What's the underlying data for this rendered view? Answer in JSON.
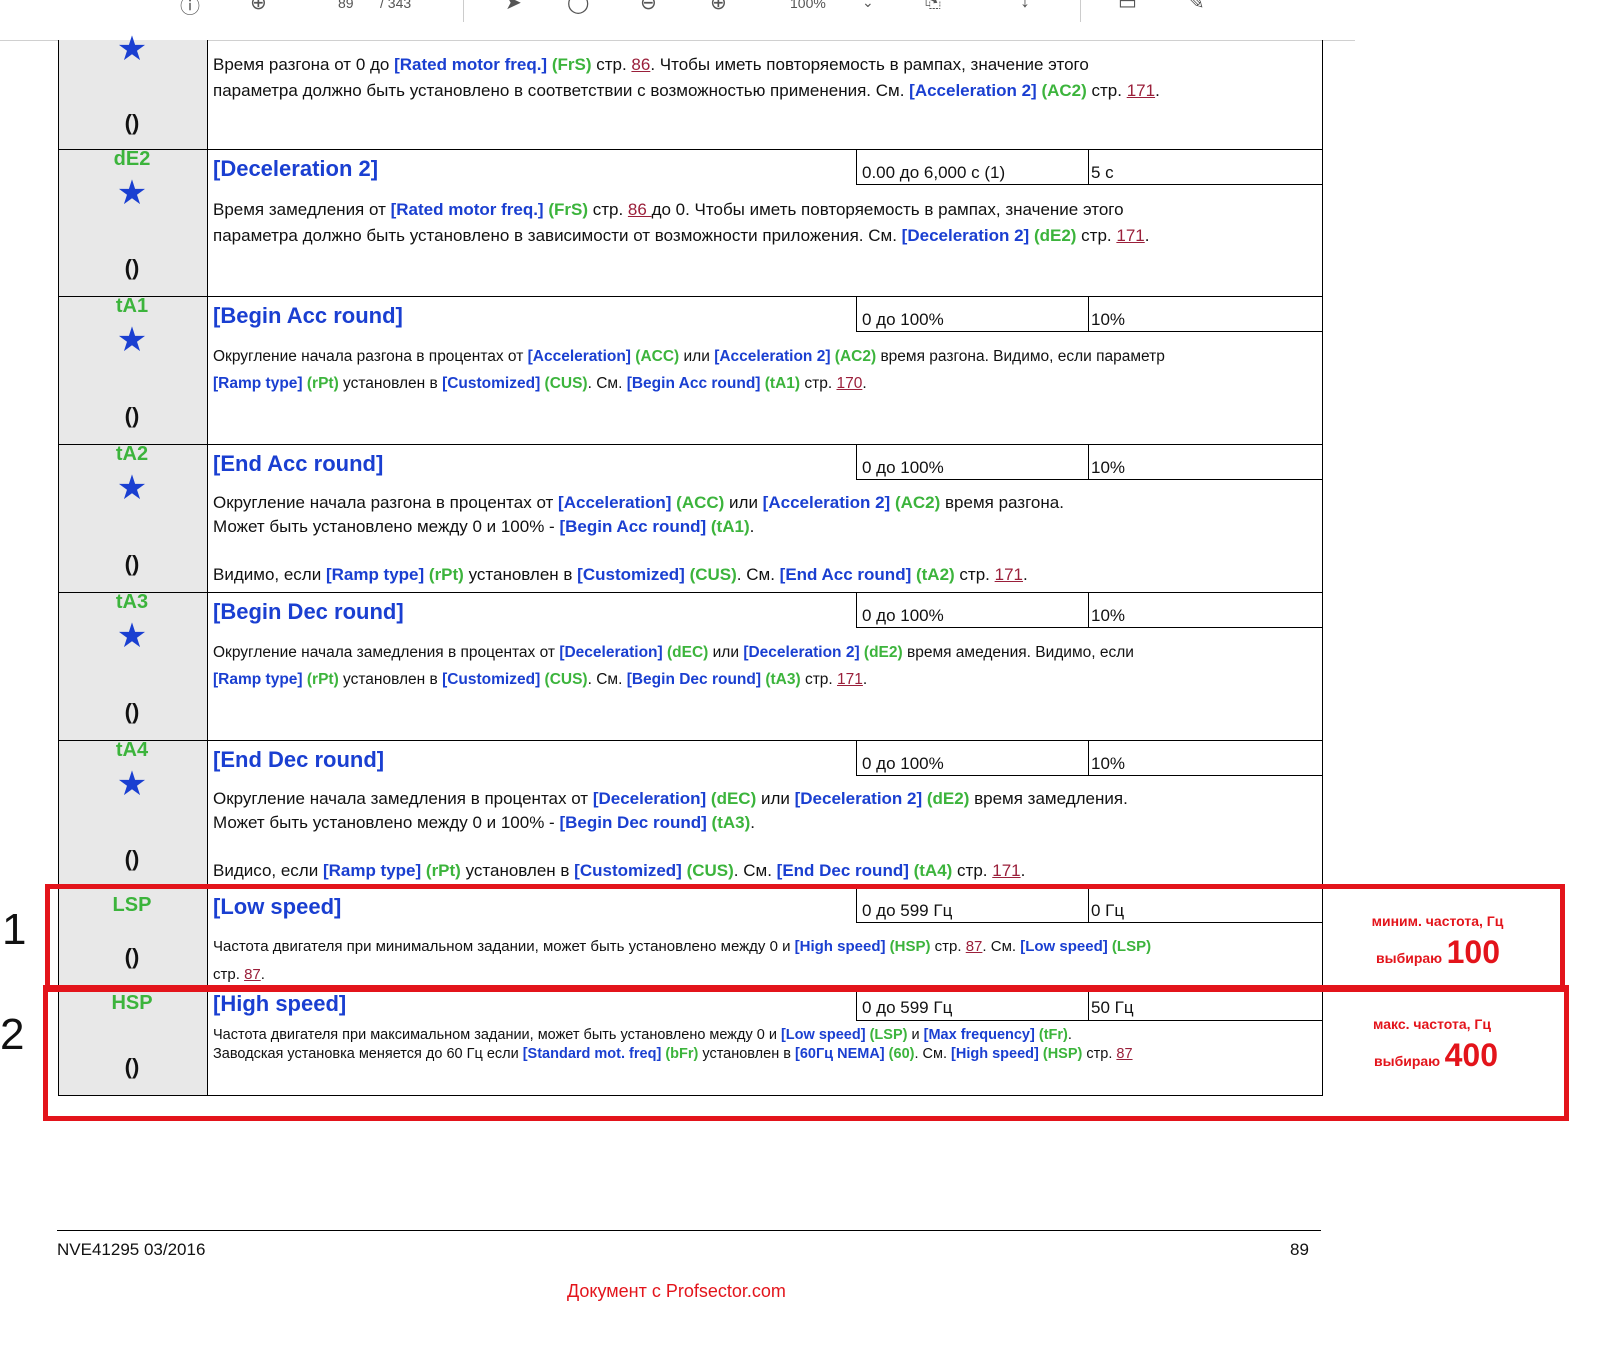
{
  "toolbar": {
    "page_current": "89",
    "page_total": "/ 343",
    "zoom": "100%"
  },
  "rows": [
    {
      "code": "",
      "title": "",
      "range": "",
      "default": "",
      "desc_html": "Время разгона от 0 до <span class=\"b\">[Rated motor freq.]</span> <span class=\"g\">(FrS)</span> стр. <span class=\"pg\">86</span>. Чтобы иметь повторяемость в рампах, значение этого<br>параметра должно быть установлено в соответствии с возможностью применения. См. <span class=\"b\">[Acceleration 2]</span> <span class=\"g\">(AC2)</span> стр. <span class=\"pg\">171</span>."
    },
    {
      "code": "dE2",
      "title": "[Deceleration 2]",
      "range": "0.00 до 6,000 с (1)",
      "default": "5 с",
      "desc_html": "Время замедления от <span class=\"b\">[Rated motor freq.]</span> <span class=\"g\">(FrS)</span> стр. <span class=\"pg\">86 </span>до 0. Чтобы иметь повторяемость в рампах, значение этого<br>параметра должно быть установлено в зависимости от возможности приложения. См. <span class=\"b\">[Deceleration 2]</span> <span class=\"g\">(dE2)</span> стр. <span class=\"pg\">171</span>."
    },
    {
      "code": "tA1",
      "title": "[Begin Acc round]",
      "range": "0 до 100%",
      "default": "10%",
      "desc_html": "Округление начала разгона в процентах от <span class=\"b\">[Acceleration]</span> <span class=\"g\">(ACC)</span> или <span class=\"b\">[Acceleration 2]</span> <span class=\"g\">(AC2)</span> время разгона. Видимо, если параметр<br><span class=\"b\">[Ramp type]</span> <span class=\"g\">(rPt)</span> установлен в <span class=\"b\">[Customized]</span> <span class=\"g\">(CUS)</span>. См. <span class=\"b\">[Begin Acc round]</span> <span class=\"g\">(tA1)</span> стр. <span class=\"pg\">170</span>."
    },
    {
      "code": "tA2",
      "title": "[End Acc round]",
      "range": "0 до 100%",
      "default": "10%",
      "desc_html": "Округление начала разгона в процентах от <span class=\"b\">[Acceleration]</span> <span class=\"g\">(ACC)</span> или <span class=\"b\">[Acceleration 2]</span> <span class=\"g\">(AC2)</span> время разгона.<br>Может быть установлено между 0 и 100% - <span class=\"b\">[Begin Acc round]</span> <span class=\"g\">(tA1)</span>.<br><br>Видимо, если <span class=\"b\">[Ramp type]</span> <span class=\"g\">(rPt)</span> установлен в <span class=\"b\">[Customized]</span> <span class=\"g\">(CUS)</span>. См. <span class=\"b\">[End Acc round]</span> <span class=\"g\">(tA2)</span> стр. <span class=\"pg\">171</span>."
    },
    {
      "code": "tA3",
      "title": "[Begin Dec round]",
      "range": "0 до 100%",
      "default": "10%",
      "desc_html": "Округление начала замедления в процентах от <span class=\"b\">[Deceleration]</span> <span class=\"g\">(dEC)</span> или <span class=\"b\">[Deceleration 2]</span> <span class=\"g\">(dE2)</span> время амедения. Видимо, если<br><span class=\"b\">[Ramp type]</span> <span class=\"g\">(rPt)</span> установлен в <span class=\"b\">[Customized]</span> <span class=\"g\">(CUS)</span>. См. <span class=\"b\">[Begin Dec round]</span> <span class=\"g\">(tA3)</span> стр. <span class=\"pg\">171</span>."
    },
    {
      "code": "tA4",
      "title": "[End Dec round]",
      "range": "0 до 100%",
      "default": "10%",
      "desc_html": "Округление начала замедления в процентах от <span class=\"b\">[Deceleration]</span> <span class=\"g\">(dEC)</span> или <span class=\"b\">[Deceleration 2]</span> <span class=\"g\">(dE2)</span> время замедления.<br>Может быть установлено между 0 и 100% - <span class=\"b\">[Begin Dec round]</span> <span class=\"g\">(tA3)</span>.<br><br>Видисо, если <span class=\"b\">[Ramp type]</span> <span class=\"g\">(rPt)</span> установлен в <span class=\"b\">[Customized]</span> <span class=\"g\">(CUS)</span>. См. <span class=\"b\">[End Dec round]</span> <span class=\"g\">(tA4)</span> стр. <span class=\"pg\">171</span>."
    },
    {
      "code": "LSP",
      "title": "[Low speed]",
      "range": "0 до 599 Гц",
      "default": "0 Гц",
      "desc_html": "Частота двигателя при минимальном задании, может быть установлено между 0 и <span class=\"b\">[High speed]</span> <span class=\"g\">(HSP)</span> стр. <span class=\"pg\">87</span>. См. <span class=\"b\">[Low speed]</span> <span class=\"g\">(LSP)</span><br>стр. <span class=\"pg\">87</span>."
    },
    {
      "code": "HSP",
      "title": "[High speed]",
      "range": "0 до 599 Гц",
      "default": "50 Гц",
      "desc_html": "Частота двигателя при максимальном задании, может быть установлено между 0 и <span class=\"b\">[Low speed]</span> <span class=\"g\">(LSP)</span> и <span class=\"b\">[Max frequency]</span> <span class=\"g\">(tFr)</span>.<br>Заводская установка меняется до 60 Гц если <span class=\"b\">[Standard mot. freq]</span> <span class=\"g\">(bFr)</span> установлен в <span class=\"b\">[60Гц NEMA]</span> <span class=\"g\">(60)</span>. См. <span class=\"b\">[High speed]</span> <span class=\"g\">(HSP)</span> стр. <span class=\"pg\">87</span>"
    }
  ],
  "annotations": [
    {
      "number": "1",
      "note": "миним. частота, Гц",
      "choose_label": "выбираю",
      "choose_value": "100"
    },
    {
      "number": "2",
      "note": "макс. частота, Гц",
      "choose_label": "выбираю",
      "choose_value": "400"
    }
  ],
  "footer": {
    "doc_id": "NVE41295 03/2016",
    "page": "89",
    "watermark": "Документ с Profsector.com"
  },
  "colors": {
    "param_blue": "#1a3fd1",
    "code_green": "#3cb43c",
    "link_red": "#9a1f3a",
    "annotation_red": "#e3141b"
  }
}
